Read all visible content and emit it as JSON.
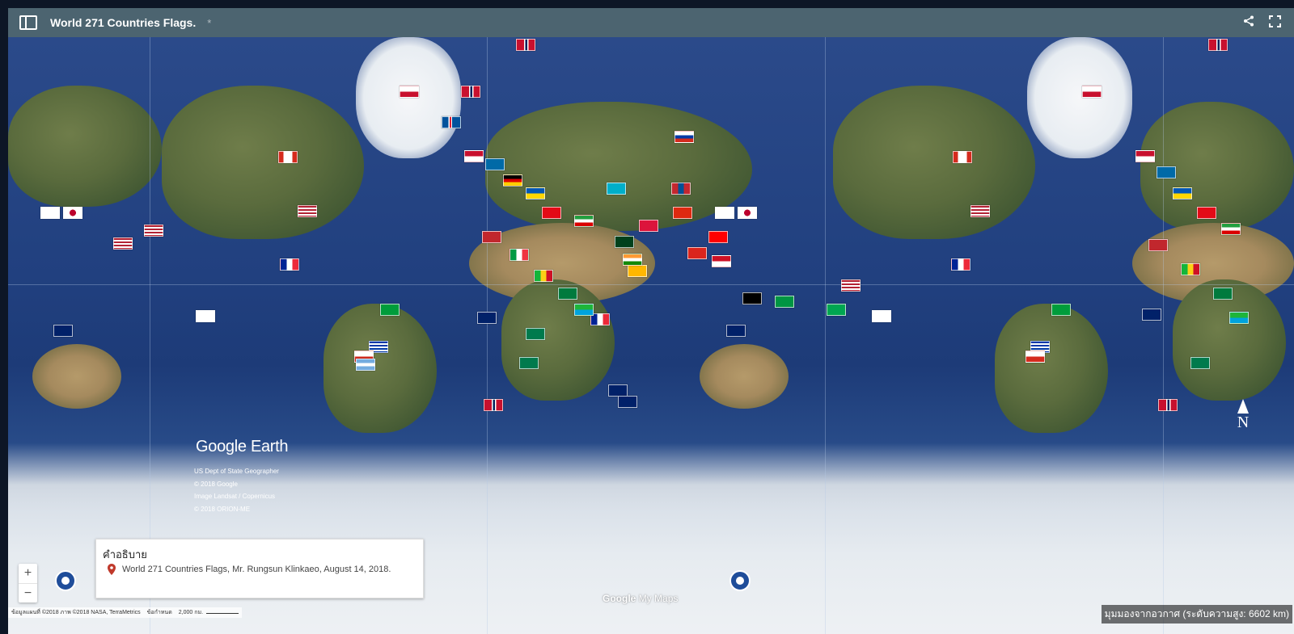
{
  "topbar": {
    "title": "World 271 Countries Flags.",
    "star": "*",
    "share_icon": "share-icon",
    "fullscreen_icon": "fullscreen-icon"
  },
  "branding": {
    "earth": "Google Earth",
    "attribution": [
      "US Dept of State Geographer",
      "© 2018 Google",
      "Image Landsat / Copernicus",
      "© 2018 ORION-ME"
    ],
    "mymaps_google": "Google",
    "mymaps_label": "My Maps"
  },
  "legend": {
    "title": "คำอธิบาย",
    "item": "World 271 Countries Flags, Mr. Rungsun Klinkaeo, August 14, 2018."
  },
  "zoom": {
    "in": "+",
    "out": "−"
  },
  "footer": {
    "data_credit": "ข้อมูลแผนที่ ©2018 ภาพ ©2018 NASA, TerraMetrics",
    "terms": "ข้อกำหนด",
    "scale": "2,000 กม."
  },
  "altitude": "มุมมองจากอวกาศ (ระดับความสูง: 6602 km)",
  "compass": "N",
  "colors": {
    "topbar": "#4c6470",
    "ocean": "#21407f"
  }
}
